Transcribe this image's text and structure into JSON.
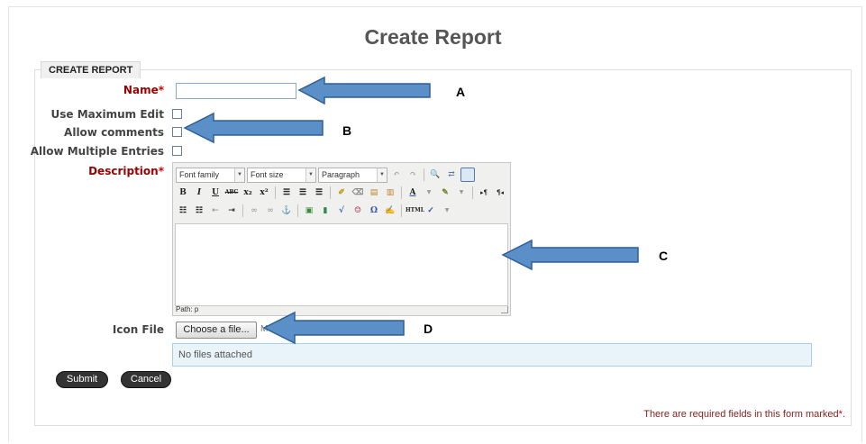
{
  "page": {
    "title": "Create Report"
  },
  "form": {
    "legend": "CREATE REPORT",
    "name_label": "Name",
    "required_star": "*",
    "use_max_edit_label": "Use Maximum Edit",
    "allow_comments_label": "Allow comments",
    "allow_multiple_label": "Allow Multiple Entries",
    "description_label": "Description",
    "icon_file_label": "Icon File",
    "choose_file_label": "Choose a file...",
    "max_size_hint": "M",
    "no_files_text": "No files attached",
    "submit_label": "Submit",
    "cancel_label": "Cancel",
    "required_note": "There are required fields in this form marked",
    "required_note_star": "*."
  },
  "editor": {
    "font_family": "Font family",
    "font_size": "Font size",
    "format": "Paragraph",
    "path_text": "Path: p",
    "toolbar_row2": [
      "B",
      "I",
      "U",
      "ABC",
      "x₂",
      "x²"
    ],
    "toolbar_row3_icons": [
      "bullet-list-icon",
      "numbered-list-icon",
      "outdent-icon",
      "indent-icon",
      "link-icon",
      "unlink-icon",
      "anchor-icon",
      "image-icon",
      "media-icon",
      "equation-icon",
      "emoticon-icon",
      "omega-icon",
      "edit-icon",
      "html-icon",
      "spellcheck-icon"
    ]
  },
  "annotations": {
    "a": "A",
    "b": "B",
    "c": "C",
    "d": "D"
  },
  "colors": {
    "arrow_fill": "#5a8fc8",
    "arrow_stroke": "#2f5f96",
    "required_label": "#990000",
    "files_box_bg": "#e9f3fa"
  }
}
